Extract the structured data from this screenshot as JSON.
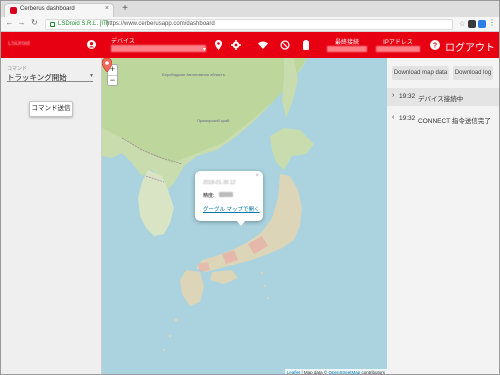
{
  "browser": {
    "tab_title": "Cerberus dashboard",
    "tab_close": "×",
    "new_tab": "+",
    "secure_text": "LSDroid S.R.L. [IT]",
    "url": "https://www.cerberusapp.com/dashboard"
  },
  "header": {
    "company": "LSDroid",
    "device_label": "デバイス",
    "last_connection_label": "最終接続",
    "ip_label": "IPアドレス",
    "logout_label": "ログアウト",
    "accent": "#e60012"
  },
  "left_panel": {
    "command_label": "コマンド",
    "command_value": "トラッキング開始",
    "send_button": "コマンド送信"
  },
  "map": {
    "zoom_in": "+",
    "zoom_out": "−",
    "label_ne": "Биробиджан Автономная область",
    "label_ne2": "Приморский край",
    "popup": {
      "close": "×",
      "date": "2018-01-30 12",
      "accuracy_label": "精度:",
      "link": "グーグル マップで開く"
    },
    "attribution_leaflet": "Leaflet",
    "attribution_mid": " | Map data © ",
    "attribution_osm": "OpenStreetMap",
    "attribution_end": " contributors"
  },
  "right_panel": {
    "download_map": "Download map data",
    "download_log": "Download log",
    "log": [
      {
        "arrow": "›",
        "time": "19:32",
        "text": "デバイス接続中"
      },
      {
        "arrow": "‹",
        "time": "19:32",
        "text": "CONNECT 指令送信完了"
      }
    ]
  }
}
